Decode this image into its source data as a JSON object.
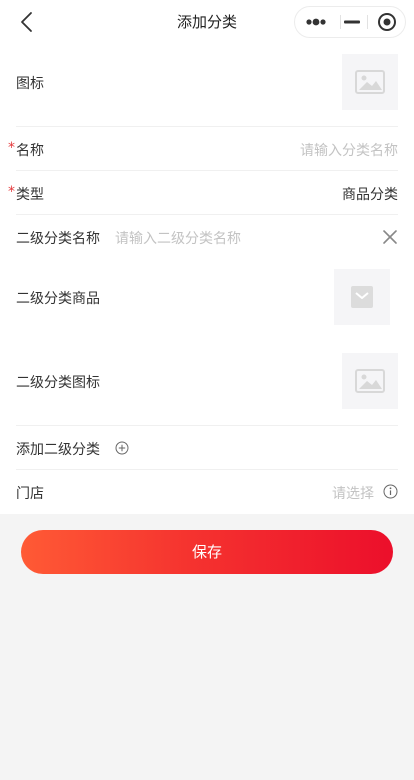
{
  "header": {
    "title": "添加分类"
  },
  "form": {
    "icon_label": "图标",
    "name": {
      "required_mark": "*",
      "label": "名称",
      "placeholder": "请输入分类名称"
    },
    "type": {
      "required_mark": "*",
      "label": "类型",
      "value": "商品分类"
    },
    "sub_category": {
      "name_label": "二级分类名称",
      "name_placeholder": "请输入二级分类名称",
      "goods_label": "二级分类商品",
      "icon_label": "二级分类图标"
    },
    "add_sub_label": "添加二级分类",
    "store": {
      "label": "门店",
      "placeholder": "请选择"
    }
  },
  "actions": {
    "save_label": "保存"
  },
  "icons": {
    "back": "chevron-left-icon",
    "more": "more-dots-icon",
    "minimize": "minus-icon",
    "close": "target-close-icon",
    "image_placeholder": "image-icon",
    "goods_placeholder": "bag-icon",
    "clear": "close-x-icon",
    "add": "plus-circle-icon",
    "info": "info-icon"
  },
  "colors": {
    "accent_start": "#ff5a35",
    "accent_end": "#ec0f2b",
    "required": "#e4393c",
    "placeholder": "#c3c3c3"
  }
}
